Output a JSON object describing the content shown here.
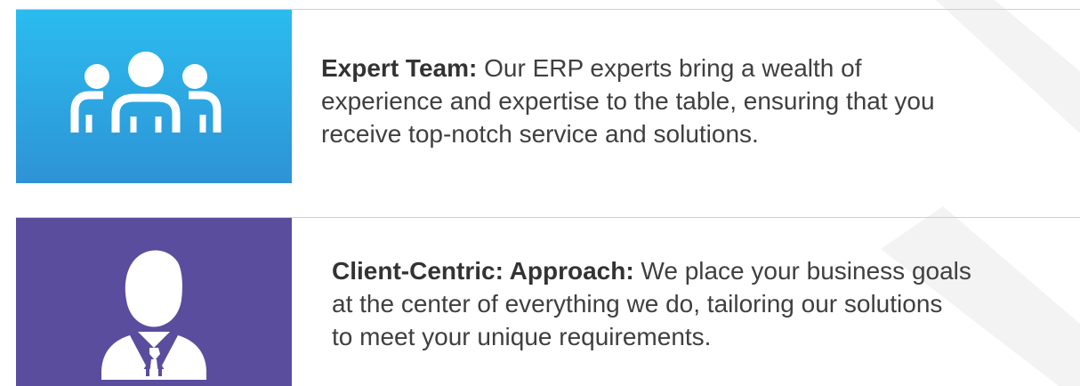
{
  "features": [
    {
      "icon": "team-icon",
      "title": "Expert Team:",
      "lines": [
        "Our ERP experts bring a wealth of",
        "experience and expertise to the table, ensuring that you",
        "receive top-notch service and solutions."
      ],
      "color": "#2ba6e4"
    },
    {
      "icon": "client-icon",
      "title": "Client-Centric: Approach:",
      "lines": [
        "We place your business goals",
        "at the center of everything we do, tailoring our solutions",
        "to meet your unique requirements."
      ],
      "color": "#5a4d9d"
    }
  ]
}
